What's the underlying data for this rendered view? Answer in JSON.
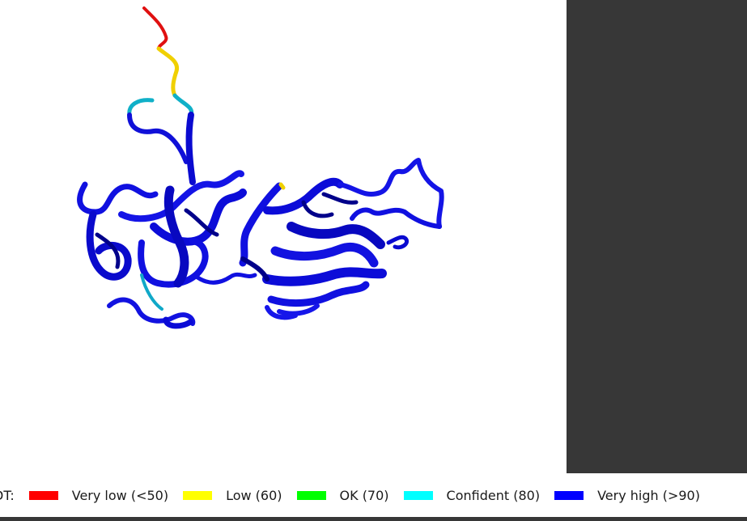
{
  "viewer": {
    "structure_name": "protein-cartoon",
    "colors": {
      "very_low": "#ff0000",
      "low": "#ffff00",
      "ok": "#00ff00",
      "confident": "#00ffff",
      "very_high": "#0000ff"
    }
  },
  "legend": {
    "title": "DT:",
    "items": [
      {
        "label": "Very low (<50)",
        "color": "#ff0000"
      },
      {
        "label": "Low (60)",
        "color": "#ffff00"
      },
      {
        "label": "OK (70)",
        "color": "#00ff00"
      },
      {
        "label": "Confident (80)",
        "color": "#00ffff"
      },
      {
        "label": "Very high (>90)",
        "color": "#0000ff"
      }
    ]
  }
}
